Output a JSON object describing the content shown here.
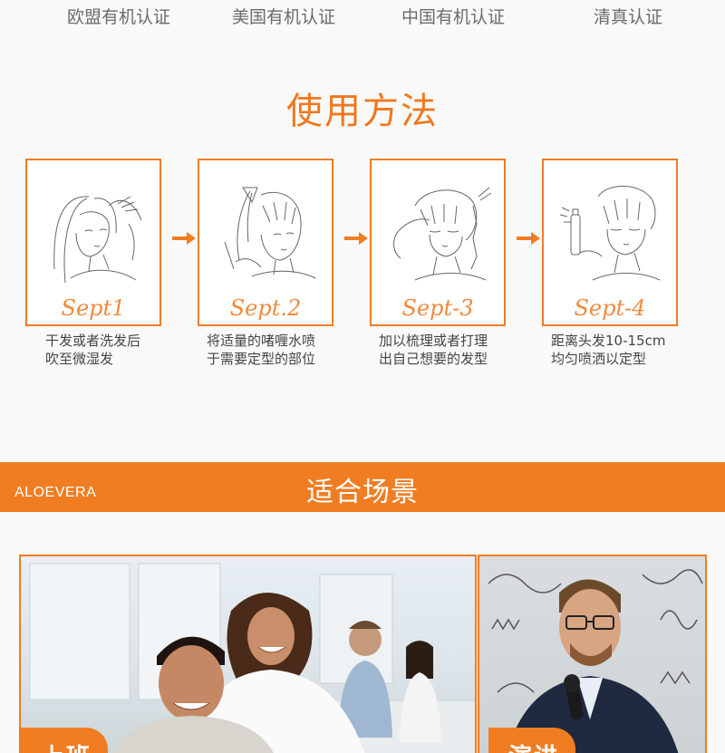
{
  "certifications": [
    "欧盟有机认证",
    "美国有机认证",
    "中国有机认证",
    "清真认证"
  ],
  "usage": {
    "title": "使用方法",
    "steps": [
      {
        "label": "Sept1",
        "desc_line1": "干发或者洗发后",
        "desc_line2": "吹至微湿发"
      },
      {
        "label": "Sept.2",
        "desc_line1": "将适量的啫喱水喷",
        "desc_line2": "于需要定型的部位"
      },
      {
        "label": "Sept-3",
        "desc_line1": "加以梳理或者打理",
        "desc_line2": "出自己想要的发型"
      },
      {
        "label": "Sept-4",
        "desc_line1": "距离头发10-15cm",
        "desc_line2": "均匀喷洒以定型"
      }
    ]
  },
  "scenes": {
    "brand": "ALOEVERA",
    "title": "适合场景",
    "photos": [
      {
        "tag": "上班",
        "icon": "office-team-photo"
      },
      {
        "tag": "演讲",
        "icon": "speaker-microphone-photo"
      }
    ]
  },
  "colors": {
    "accent": "#f07d22",
    "text": "#444444",
    "cert_text": "#6b6b6b"
  }
}
